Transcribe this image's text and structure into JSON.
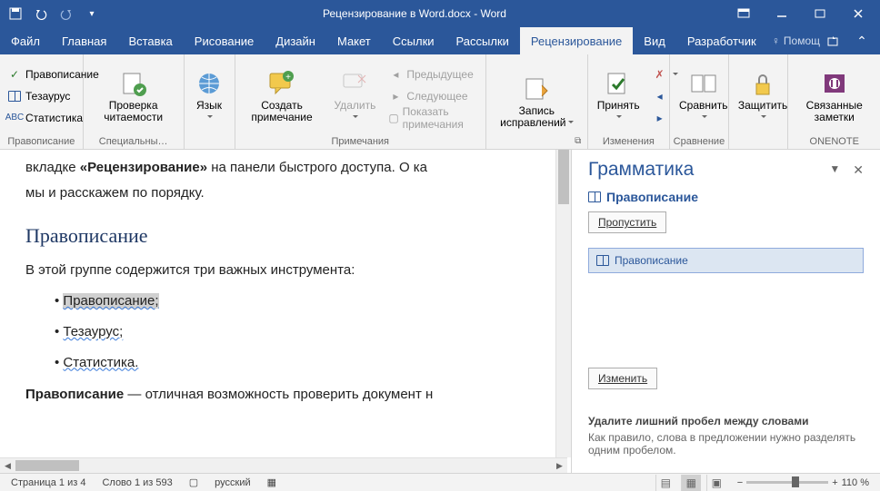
{
  "titlebar": {
    "title": "Рецензирование в Word.docx - Word"
  },
  "tabs": [
    "Файл",
    "Главная",
    "Вставка",
    "Рисование",
    "Дизайн",
    "Макет",
    "Ссылки",
    "Рассылки",
    "Рецензирование",
    "Вид",
    "Разработчик"
  ],
  "active_tab_index": 8,
  "help_hint": "Помощ",
  "ribbon": {
    "proofing": {
      "spelling": "Правописание",
      "thesaurus": "Тезаурус",
      "statistics": "Статистика",
      "group": "Правописание"
    },
    "accessibility": {
      "check": "Проверка читаемости",
      "group": "Специальны…"
    },
    "language": {
      "btn": "Язык"
    },
    "comments": {
      "new": "Создать примечание",
      "delete": "Удалить",
      "prev": "Предыдущее",
      "next": "Следующее",
      "show": "Показать примечания",
      "group": "Примечания"
    },
    "tracking": {
      "track": "Запись исправлений",
      "accept": "Принять",
      "compare": "Сравнить",
      "protect": "Защитить",
      "group_changes": "Изменения",
      "group_compare": "Сравнение"
    },
    "onenote": {
      "btn": "Связанные заметки",
      "group": "ONENOTE"
    }
  },
  "document": {
    "para1a": "вкладке ",
    "para1b": "«Рецензирование»",
    "para1c": " на панели быстрого доступа. О ка",
    "para2": "мы и расскажем по порядку.",
    "heading": "Правописание",
    "para3": "В этой группе содержится три важных инструмента:",
    "bullets": [
      "Правописание;",
      "Тезаурус;",
      "Статистика."
    ],
    "para4a": "Правописание",
    "para4b": " — отличная возможность проверить документ н"
  },
  "pane": {
    "title": "Грамматика",
    "subhead": "Правописание",
    "skip": "Пропустить",
    "suggestion": "Правописание",
    "change": "Изменить",
    "expl_title": "Удалите лишний пробел между словами",
    "expl_text": "Как правило, слова в предложении нужно разделять одним пробелом."
  },
  "statusbar": {
    "page": "Страница 1 из 4",
    "words": "Слово 1 из 593",
    "lang": "русский",
    "zoom": "110 %"
  }
}
